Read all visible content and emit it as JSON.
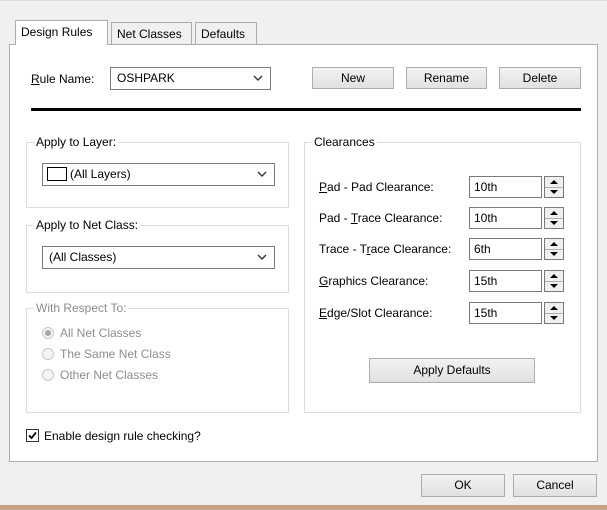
{
  "tabs": [
    {
      "label": "Design Rules",
      "active": true
    },
    {
      "label": "Net Classes",
      "active": false
    },
    {
      "label": "Defaults",
      "active": false
    }
  ],
  "rule": {
    "name_label": "Rule Name:",
    "name_value": "OSHPARK",
    "new_label": "New",
    "rename_label": "Rename",
    "delete_label": "Delete"
  },
  "apply_layer": {
    "label": "Apply to Layer:",
    "value": "(All Layers)"
  },
  "apply_net_class": {
    "label": "Apply to Net Class:",
    "value": "(All Classes)"
  },
  "respect": {
    "label": "With Respect To:",
    "options": [
      "All Net Classes",
      "The Same Net Class",
      "Other Net Classes"
    ],
    "selected_index": 0
  },
  "clearances": {
    "label": "Clearances",
    "rows": [
      {
        "label": "Pad - Pad Clearance:",
        "value": "10th"
      },
      {
        "label": "Pad - Trace Clearance:",
        "value": "10th"
      },
      {
        "label": "Trace - Trace Clearance:",
        "value": "6th"
      },
      {
        "label": "Graphics Clearance:",
        "value": "15th"
      },
      {
        "label": "Edge/Slot Clearance:",
        "value": "15th"
      }
    ],
    "apply_defaults_label": "Apply Defaults"
  },
  "enable_drc": {
    "label": "Enable design rule checking?",
    "checked": true
  },
  "footer": {
    "ok_label": "OK",
    "cancel_label": "Cancel"
  },
  "colors": {
    "window_bg": "#f0f0f0",
    "panel_bg": "#ffffff",
    "desktop_bg": "#c8a282",
    "disabled_text": "#8d8d8d"
  }
}
